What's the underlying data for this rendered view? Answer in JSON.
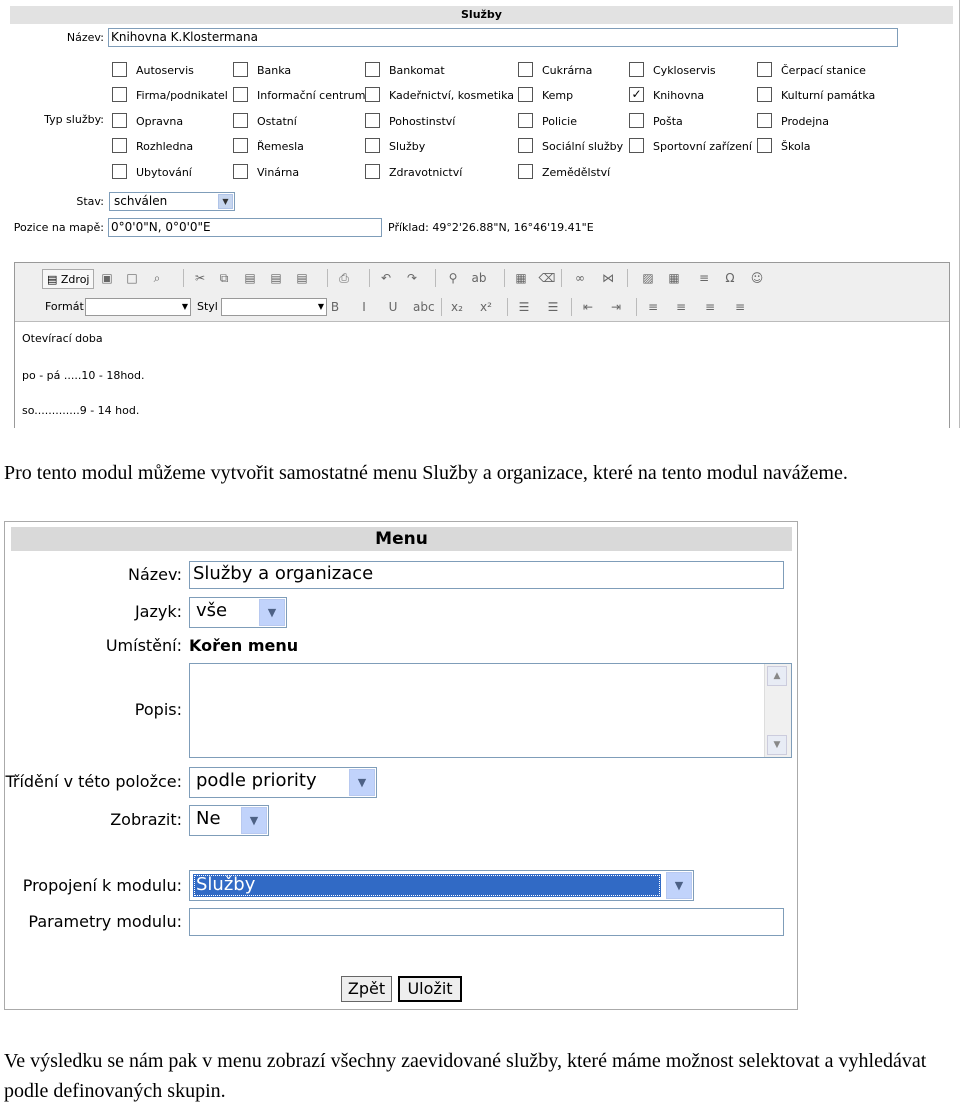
{
  "top_form": {
    "title": "Služby",
    "name_label": "Název:",
    "name_value": "Knihovna K.Klostermana",
    "type_label": "Typ služby:",
    "services": [
      {
        "label": "Autoservis",
        "checked": false
      },
      {
        "label": "Banka",
        "checked": false
      },
      {
        "label": "Bankomat",
        "checked": false
      },
      {
        "label": "Cukrárna",
        "checked": false
      },
      {
        "label": "Cykloservis",
        "checked": false
      },
      {
        "label": "Čerpací stanice",
        "checked": false
      },
      {
        "label": "Firma/podnikatel",
        "checked": false
      },
      {
        "label": "Informační centrum",
        "checked": false
      },
      {
        "label": "Kadeřnictví, kosmetika",
        "checked": false
      },
      {
        "label": "Kemp",
        "checked": false
      },
      {
        "label": "Knihovna",
        "checked": true
      },
      {
        "label": "Kulturní památka",
        "checked": false
      },
      {
        "label": "Opravna",
        "checked": false
      },
      {
        "label": "Ostatní",
        "checked": false
      },
      {
        "label": "Pohostinství",
        "checked": false
      },
      {
        "label": "Policie",
        "checked": false
      },
      {
        "label": "Pošta",
        "checked": false
      },
      {
        "label": "Prodejna",
        "checked": false
      },
      {
        "label": "Rozhledna",
        "checked": false
      },
      {
        "label": "Řemesla",
        "checked": false
      },
      {
        "label": "Služby",
        "checked": false
      },
      {
        "label": "Sociální služby",
        "checked": false
      },
      {
        "label": "Sportovní zařízení",
        "checked": false
      },
      {
        "label": "Škola",
        "checked": false
      },
      {
        "label": "Ubytování",
        "checked": false
      },
      {
        "label": "Vinárna",
        "checked": false
      },
      {
        "label": "Zdravotnictví",
        "checked": false
      },
      {
        "label": "Zemědělství",
        "checked": false
      }
    ],
    "status_label": "Stav:",
    "status_value": "schválen",
    "map_label": "Pozice na mapě:",
    "map_value": "0°0'0\"N, 0°0'0\"E",
    "map_example": "Příklad: 49°2'26.88\"N, 16°46'19.41\"E",
    "editor": {
      "source_button": "Zdroj",
      "format_label": "Formát",
      "style_label": "Styl",
      "lines": [
        "Otevírací doba",
        "po - pá .....10 - 18hod.",
        "so.............9 - 14 hod."
      ]
    }
  },
  "paragraph1": "Pro tento modul můžeme vytvořit samostatné menu Služby a organizace, které na tento modul navážeme.",
  "menu_form": {
    "title": "Menu",
    "name_label": "Název:",
    "name_value": "Služby a organizace",
    "language_label": "Jazyk:",
    "language_value": "vše",
    "placement_label": "Umístění:",
    "placement_value": "Kořen menu",
    "description_label": "Popis:",
    "sorting_label": "Třídění v této položce:",
    "sorting_value": "podle priority",
    "show_label": "Zobrazit:",
    "show_value": "Ne",
    "module_label": "Propojení k modulu:",
    "module_value": "Služby",
    "params_label": "Parametry modulu:",
    "params_value": "",
    "back_button": "Zpět",
    "save_button": "Uložit"
  },
  "paragraph2": "Ve výsledku se nám pak v menu zobrazí všechny zaevidované služby, které máme možnost selektovat a vyhledávat podle definovaných skupin.",
  "colors": {
    "title_bar": "#e2e2e2",
    "select_button": "#c1d3fb",
    "highlight": "#316ac5"
  }
}
